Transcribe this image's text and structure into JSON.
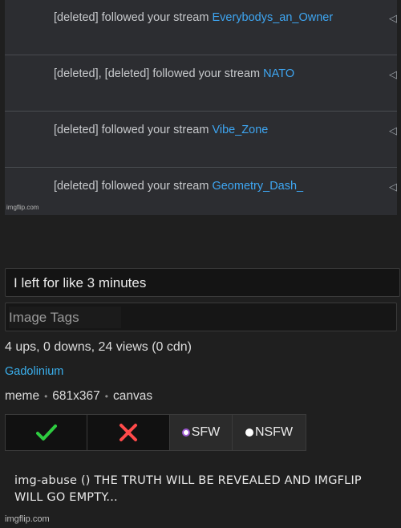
{
  "notifications": [
    {
      "text": "[deleted] followed your stream ",
      "stream": "Everybodys_an_Owner"
    },
    {
      "text": "[deleted], [deleted] followed your stream ",
      "stream": "NATO"
    },
    {
      "text": "[deleted] followed your stream ",
      "stream": "Vibe_Zone"
    },
    {
      "text": "[deleted] followed your stream ",
      "stream": "Geometry_Dash_"
    }
  ],
  "image_watermark": "imgflip.com",
  "form": {
    "title_value": "I left for like 3 minutes",
    "tags_placeholder": "Image Tags"
  },
  "stats": "4 ups, 0 downs, 24 views (0 cdn)",
  "author": "Gadolinium",
  "meta": {
    "type": "meme",
    "dimensions": "681x367",
    "source": "canvas",
    "separator": "•"
  },
  "vote": {
    "sfw_label": "SFW",
    "nsfw_label": "NSFW",
    "upvote_icon": "check-icon",
    "downvote_icon": "x-icon"
  },
  "comment": "img-abuse () THE TRUTH WILL BE REVEALED AND IMGFLIP WILL GO EMPTY...",
  "footer_watermark": "imgflip.com",
  "colors": {
    "link": "#3ab0ee",
    "stream_link": "#3ea6f2",
    "upvote": "#2ecc40",
    "downvote": "#ff4a4a",
    "sfw_radio": "#9b59d0"
  }
}
